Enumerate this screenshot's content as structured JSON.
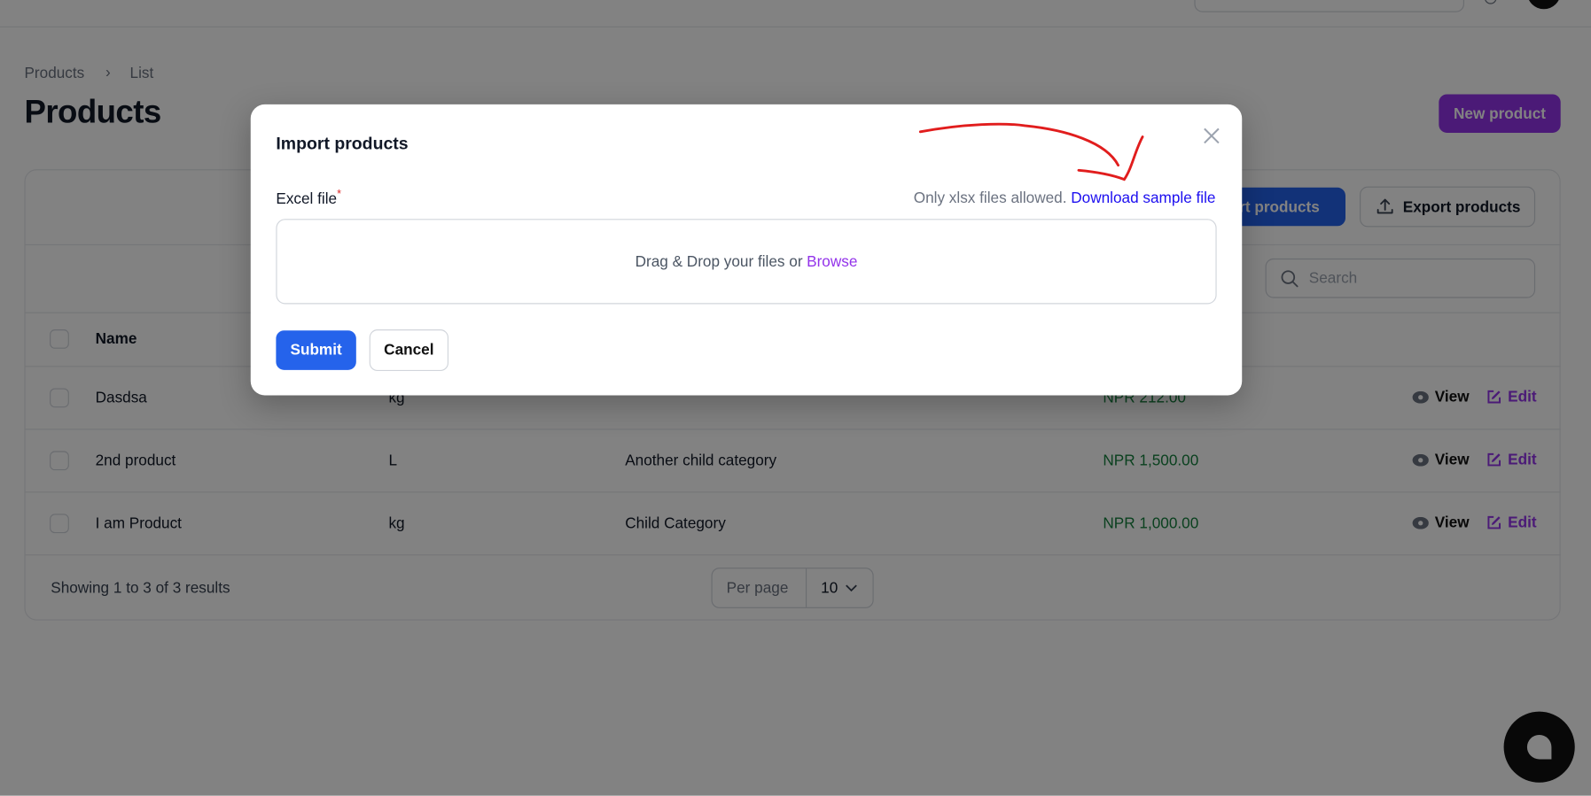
{
  "colors": {
    "primary": "#2563eb",
    "accent": "#9333ea",
    "price": "#15803d",
    "annotation": "#e11d1d"
  },
  "breadcrumb": {
    "items": [
      "Products",
      "List"
    ]
  },
  "header": {
    "title": "Products",
    "new_button": "New product"
  },
  "toolbar": {
    "import_label": "Import products",
    "export_label": "Export products",
    "search_placeholder": "Search"
  },
  "table": {
    "columns": [
      "Name"
    ],
    "rows": [
      {
        "name": "Dasdsa",
        "unit": "kg",
        "category": "",
        "price": "NPR 212.00"
      },
      {
        "name": "2nd product",
        "unit": "L",
        "category": "Another child category",
        "price": "NPR 1,500.00"
      },
      {
        "name": "I am Product",
        "unit": "kg",
        "category": "Child Category",
        "price": "NPR 1,000.00"
      }
    ],
    "view_label": "View",
    "edit_label": "Edit"
  },
  "footer": {
    "summary": "Showing 1 to 3 of 3 results",
    "per_page_label": "Per page",
    "per_page_value": "10"
  },
  "modal": {
    "title": "Import products",
    "field_label": "Excel file",
    "required_mark": "*",
    "hint": "Only xlsx files allowed.",
    "download_link": "Download sample file",
    "drop_text": "Drag & Drop your files or",
    "browse_label": "Browse",
    "submit_label": "Submit",
    "cancel_label": "Cancel"
  }
}
